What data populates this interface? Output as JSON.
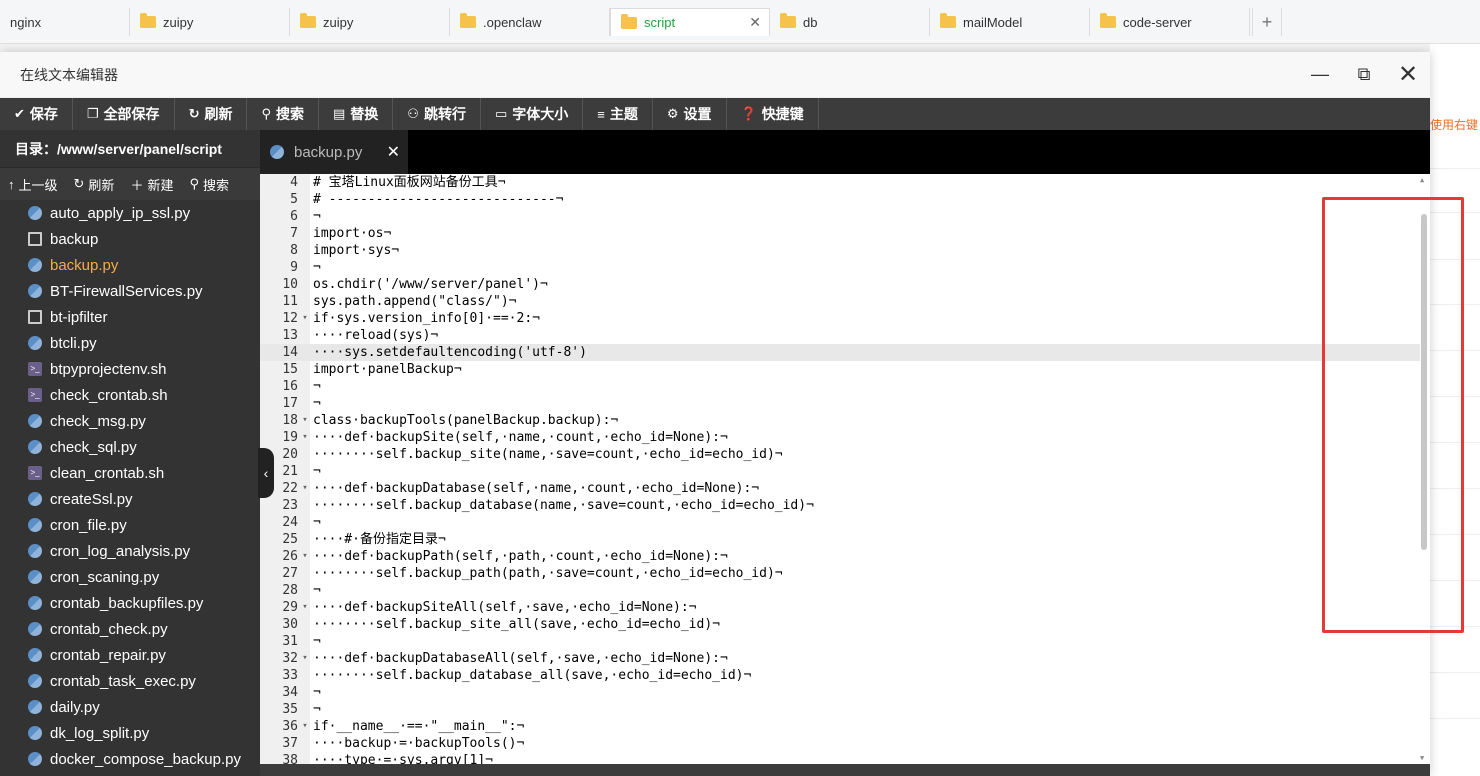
{
  "browser_tabs": [
    {
      "label": "nginx",
      "active": false,
      "icon": "none"
    },
    {
      "label": "zuipy",
      "active": false,
      "icon": "folder-icon"
    },
    {
      "label": "zuipy",
      "active": false,
      "icon": "folder-icon"
    },
    {
      "label": ".openclaw",
      "active": false,
      "icon": "folder-icon"
    },
    {
      "label": "script",
      "active": true,
      "icon": "folder-icon"
    },
    {
      "label": "db",
      "active": false,
      "icon": "folder-icon"
    },
    {
      "label": "mailModel",
      "active": false,
      "icon": "folder-icon"
    },
    {
      "label": "code-server",
      "active": false,
      "icon": "folder-icon"
    }
  ],
  "background_hint": "使用右键",
  "window": {
    "title": "在线文本编辑器",
    "minimize": "—",
    "maximize": "⧉",
    "close": "✕"
  },
  "toolbar": {
    "save": "保存",
    "save_all": "全部保存",
    "refresh": "刷新",
    "search": "搜索",
    "replace": "替换",
    "goto": "跳转行",
    "font_size": "字体大小",
    "theme": "主题",
    "settings": "设置",
    "shortcuts": "快捷键"
  },
  "sidebar": {
    "path": "目录：/www/server/panel/script",
    "actions": {
      "up": "上一级",
      "refresh": "刷新",
      "new": "新建",
      "search": "搜索"
    },
    "files": [
      {
        "name": "auto_apply_ip_ssl.py",
        "type": "py",
        "active": false
      },
      {
        "name": "backup",
        "type": "doc",
        "active": false
      },
      {
        "name": "backup.py",
        "type": "py",
        "active": true
      },
      {
        "name": "BT-FirewallServices.py",
        "type": "py",
        "active": false
      },
      {
        "name": "bt-ipfilter",
        "type": "doc",
        "active": false
      },
      {
        "name": "btcli.py",
        "type": "py",
        "active": false
      },
      {
        "name": "btpyprojectenv.sh",
        "type": "sh",
        "active": false
      },
      {
        "name": "check_crontab.sh",
        "type": "sh",
        "active": false
      },
      {
        "name": "check_msg.py",
        "type": "py",
        "active": false
      },
      {
        "name": "check_sql.py",
        "type": "py",
        "active": false
      },
      {
        "name": "clean_crontab.sh",
        "type": "sh",
        "active": false
      },
      {
        "name": "createSsl.py",
        "type": "py",
        "active": false
      },
      {
        "name": "cron_file.py",
        "type": "py",
        "active": false
      },
      {
        "name": "cron_log_analysis.py",
        "type": "py",
        "active": false
      },
      {
        "name": "cron_scaning.py",
        "type": "py",
        "active": false
      },
      {
        "name": "crontab_backupfiles.py",
        "type": "py",
        "active": false
      },
      {
        "name": "crontab_check.py",
        "type": "py",
        "active": false
      },
      {
        "name": "crontab_repair.py",
        "type": "py",
        "active": false
      },
      {
        "name": "crontab_task_exec.py",
        "type": "py",
        "active": false
      },
      {
        "name": "daily.py",
        "type": "py",
        "active": false
      },
      {
        "name": "dk_log_split.py",
        "type": "py",
        "active": false
      },
      {
        "name": "docker_compose_backup.py",
        "type": "py",
        "active": false
      }
    ]
  },
  "editor": {
    "open_tab": "backup.py",
    "current_line": 14,
    "lines": [
      {
        "n": "4",
        "fold": false,
        "text": "# 宝塔Linux面板网站备份工具¬"
      },
      {
        "n": "5",
        "fold": false,
        "text": "# -----------------------------¬"
      },
      {
        "n": "6",
        "fold": false,
        "text": "¬"
      },
      {
        "n": "7",
        "fold": false,
        "text": "import·os¬"
      },
      {
        "n": "8",
        "fold": false,
        "text": "import·sys¬"
      },
      {
        "n": "9",
        "fold": false,
        "text": "¬"
      },
      {
        "n": "10",
        "fold": false,
        "text": "os.chdir('/www/server/panel')¬"
      },
      {
        "n": "11",
        "fold": false,
        "text": "sys.path.append(\"class/\")¬"
      },
      {
        "n": "12",
        "fold": true,
        "text": "if·sys.version_info[0]·==·2:¬"
      },
      {
        "n": "13",
        "fold": false,
        "text": "····reload(sys)¬"
      },
      {
        "n": "14",
        "fold": false,
        "text": "····sys.setdefaultencoding('utf-8')"
      },
      {
        "n": "15",
        "fold": false,
        "text": "import·panelBackup¬"
      },
      {
        "n": "16",
        "fold": false,
        "text": "¬"
      },
      {
        "n": "17",
        "fold": false,
        "text": "¬"
      },
      {
        "n": "18",
        "fold": true,
        "text": "class·backupTools(panelBackup.backup):¬"
      },
      {
        "n": "19",
        "fold": true,
        "text": "····def·backupSite(self,·name,·count,·echo_id=None):¬"
      },
      {
        "n": "20",
        "fold": false,
        "text": "········self.backup_site(name,·save=count,·echo_id=echo_id)¬"
      },
      {
        "n": "21",
        "fold": false,
        "text": "¬"
      },
      {
        "n": "22",
        "fold": true,
        "text": "····def·backupDatabase(self,·name,·count,·echo_id=None):¬"
      },
      {
        "n": "23",
        "fold": false,
        "text": "········self.backup_database(name,·save=count,·echo_id=echo_id)¬"
      },
      {
        "n": "24",
        "fold": false,
        "text": "¬"
      },
      {
        "n": "25",
        "fold": false,
        "text": "····#·备份指定目录¬"
      },
      {
        "n": "26",
        "fold": true,
        "text": "····def·backupPath(self,·path,·count,·echo_id=None):¬"
      },
      {
        "n": "27",
        "fold": false,
        "text": "········self.backup_path(path,·save=count,·echo_id=echo_id)¬"
      },
      {
        "n": "28",
        "fold": false,
        "text": "¬"
      },
      {
        "n": "29",
        "fold": true,
        "text": "····def·backupSiteAll(self,·save,·echo_id=None):¬"
      },
      {
        "n": "30",
        "fold": false,
        "text": "········self.backup_site_all(save,·echo_id=echo_id)¬"
      },
      {
        "n": "31",
        "fold": false,
        "text": "¬"
      },
      {
        "n": "32",
        "fold": true,
        "text": "····def·backupDatabaseAll(self,·save,·echo_id=None):¬"
      },
      {
        "n": "33",
        "fold": false,
        "text": "········self.backup_database_all(save,·echo_id=echo_id)¬"
      },
      {
        "n": "34",
        "fold": false,
        "text": "¬"
      },
      {
        "n": "35",
        "fold": false,
        "text": "¬"
      },
      {
        "n": "36",
        "fold": true,
        "text": "if·__name__·==·\"__main__\":¬"
      },
      {
        "n": "37",
        "fold": false,
        "text": "····backup·=·backupTools()¬"
      },
      {
        "n": "38",
        "fold": false,
        "text": "····type·=·sys.argv[1]¬"
      }
    ]
  },
  "colors": {
    "toolbar_bg": "#3c3c3c",
    "sidebar_bg": "#333333",
    "active_file": "#f0ad4e",
    "active_browser_tab": "#20a53a",
    "highlight_box": "#e53935"
  }
}
